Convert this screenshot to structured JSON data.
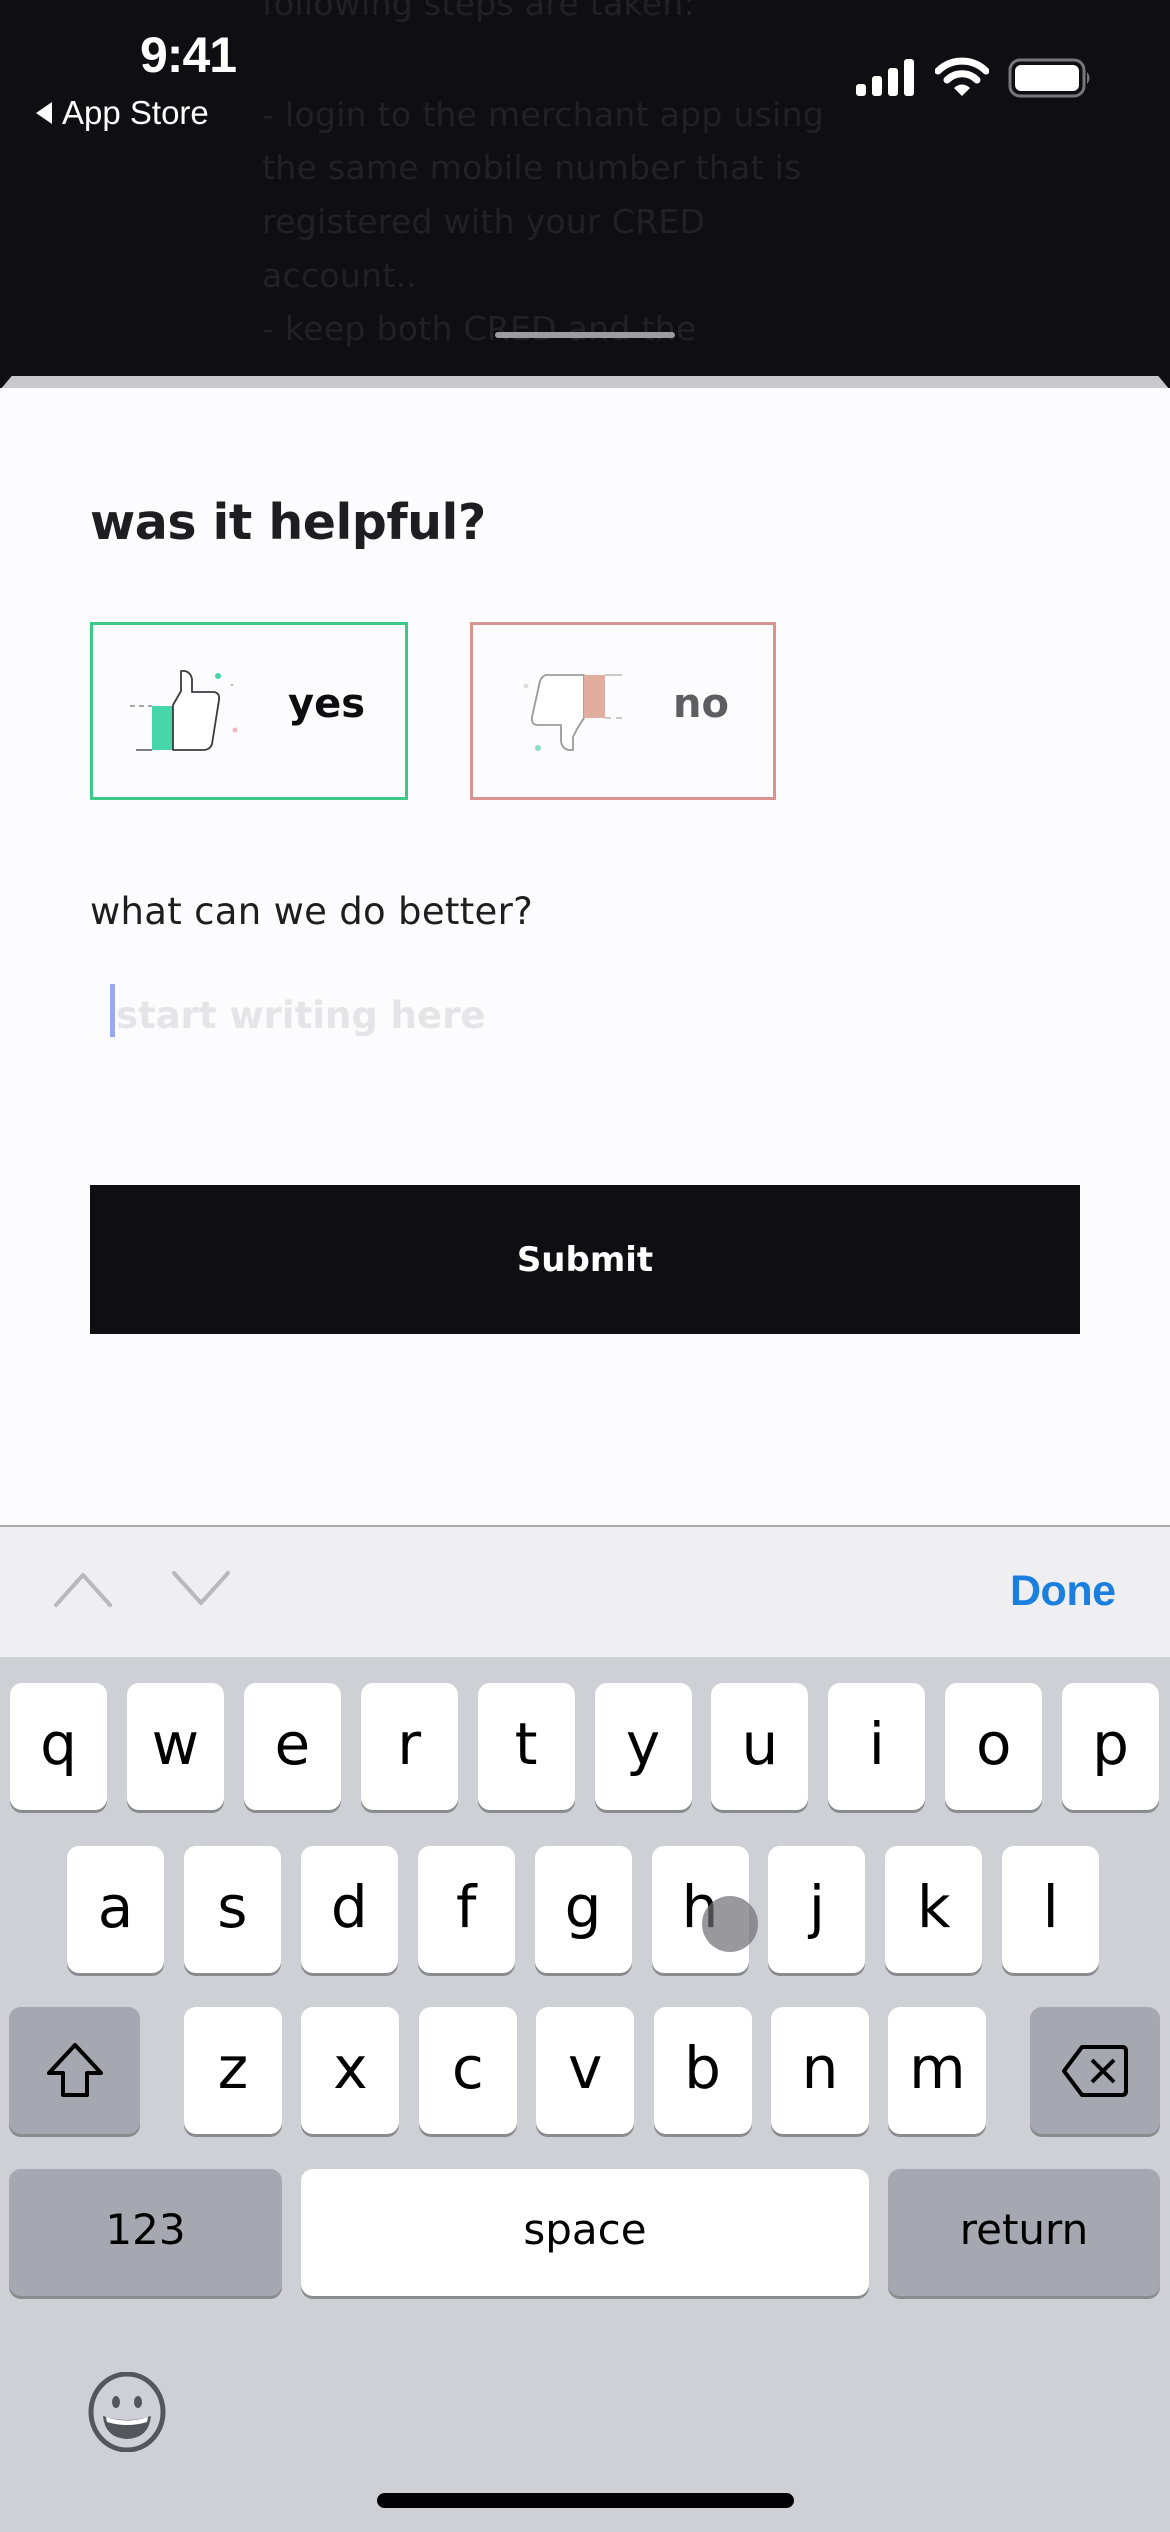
{
  "status_bar": {
    "time": "9:41",
    "back_label": "App Store",
    "icons": [
      "signal-icon",
      "wifi-icon",
      "battery-icon"
    ]
  },
  "background_article": {
    "lines": [
      "following steps are taken:",
      "- login to the merchant app using",
      "the same mobile number that is",
      "registered with your CRED",
      "account..",
      "- keep both CRED and the"
    ]
  },
  "sheet": {
    "title": "was it helpful?",
    "choices": [
      {
        "label": "yes",
        "icon": "thumbs-up-icon",
        "accent": "#3cc98a"
      },
      {
        "label": "no",
        "icon": "thumbs-down-icon",
        "accent": "#d9948f"
      }
    ],
    "feedback_label": "what can we do better?",
    "feedback_placeholder": "start writing here",
    "feedback_value": "",
    "submit_label": "Submit"
  },
  "toolbar": {
    "prev_icon": "chevron-up-icon",
    "next_icon": "chevron-down-icon",
    "done_label": "Done"
  },
  "keyboard": {
    "row1": [
      "q",
      "w",
      "e",
      "r",
      "t",
      "y",
      "u",
      "i",
      "o",
      "p"
    ],
    "row2": [
      "a",
      "s",
      "d",
      "f",
      "g",
      "h",
      "j",
      "k",
      "l"
    ],
    "row3": [
      "z",
      "x",
      "c",
      "v",
      "b",
      "n",
      "m"
    ],
    "numbers_label": "123",
    "space_label": "space",
    "return_label": "return",
    "shift_icon": "shift-icon",
    "delete_icon": "delete-icon",
    "emoji_icon": "emoji-icon"
  },
  "colors": {
    "yes_accent": "#3cc98a",
    "no_accent": "#d9948f",
    "link_blue": "#1b7fe0",
    "dark": "#0f0e12"
  }
}
